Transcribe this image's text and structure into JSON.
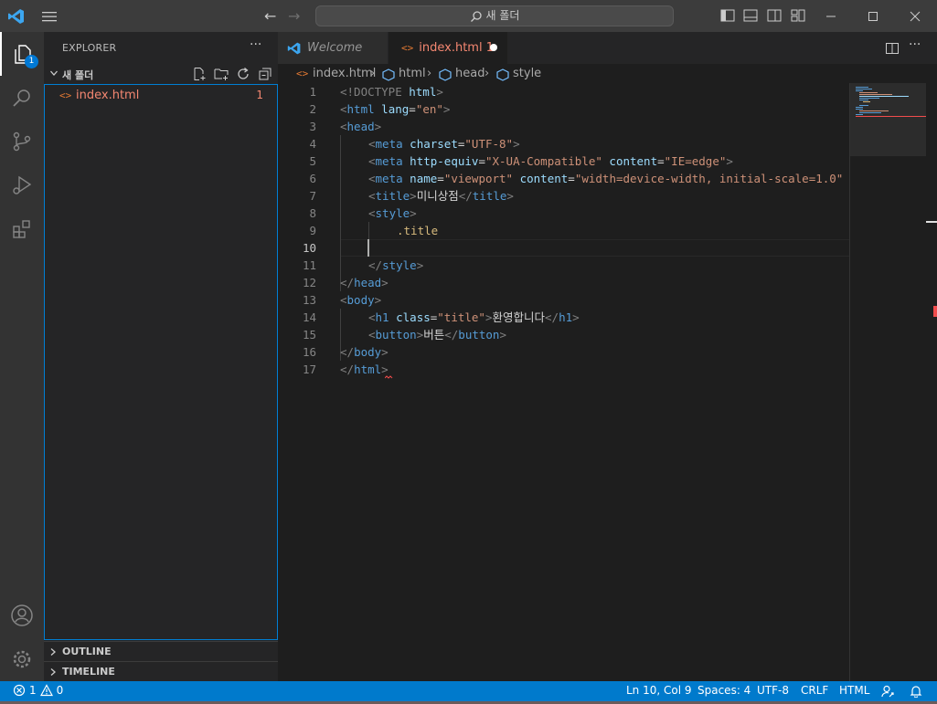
{
  "titlebar": {
    "search": "새 폴더"
  },
  "activity": {
    "explorer_badge": "1"
  },
  "sidebar": {
    "header": "EXPLORER",
    "more": "···",
    "folder": "새 폴더",
    "files": [
      {
        "name": "index.html",
        "problems": "1"
      }
    ],
    "outline": "OUTLINE",
    "timeline": "TIMELINE"
  },
  "tabs": [
    {
      "label": "Welcome"
    },
    {
      "label": "index.html 1"
    }
  ],
  "breadcrumb": [
    "index.html",
    "html",
    "head",
    "style"
  ],
  "code_lines": [
    "1",
    "2",
    "3",
    "4",
    "5",
    "6",
    "7",
    "8",
    "9",
    "10",
    "11",
    "12",
    "13",
    "14",
    "15",
    "16",
    "17"
  ],
  "code": {
    "l1a": "<!DOCTYPE",
    "l1b": " html",
    "l1c": ">",
    "l2a": "<",
    "l2b": "html",
    "l2c": " lang",
    "l2d": "=",
    "l2e": "\"en\"",
    "l2f": ">",
    "l3a": "<",
    "l3b": "head",
    "l3c": ">",
    "l4a": "<",
    "l4b": "meta",
    "l4c": " charset",
    "l4d": "=",
    "l4e": "\"UTF-8\"",
    "l4f": ">",
    "l5a": "<",
    "l5b": "meta",
    "l5c": " http-equiv",
    "l5d": "=",
    "l5e": "\"X-UA-Compatible\"",
    "l5f": " content",
    "l5g": "=",
    "l5h": "\"IE=edge\"",
    "l5i": ">",
    "l6a": "<",
    "l6b": "meta",
    "l6c": " name",
    "l6d": "=",
    "l6e": "\"viewport\"",
    "l6f": " content",
    "l6g": "=",
    "l6h": "\"width=device-width, initial-scale=1.0\"",
    "l7a": "<",
    "l7b": "title",
    "l7c": ">",
    "l7d": "미니상점",
    "l7e": "</",
    "l7f": "title",
    "l7g": ">",
    "l8a": "<",
    "l8b": "style",
    "l8c": ">",
    "l9": ".title",
    "l11a": "</",
    "l11b": "style",
    "l11c": ">",
    "l12a": "</",
    "l12b": "head",
    "l12c": ">",
    "l13a": "<",
    "l13b": "body",
    "l13c": ">",
    "l14a": "<",
    "l14b": "h1",
    "l14c": " class",
    "l14d": "=",
    "l14e": "\"title\"",
    "l14f": ">",
    "l14g": "환영합니다",
    "l14h": "</",
    "l14i": "h1",
    "l14j": ">",
    "l15a": "<",
    "l15b": "button",
    "l15c": ">",
    "l15d": "버튼",
    "l15e": "</",
    "l15f": "button",
    "l15g": ">",
    "l16a": "</",
    "l16b": "body",
    "l16c": ">",
    "l17a": "</",
    "l17b": "html",
    "l17c": ">"
  },
  "status": {
    "errors": "1",
    "warnings": "0",
    "position": "Ln 10, Col 9",
    "spaces": "Spaces: 4",
    "encoding": "UTF-8",
    "eol": "CRLF",
    "language": "HTML"
  }
}
